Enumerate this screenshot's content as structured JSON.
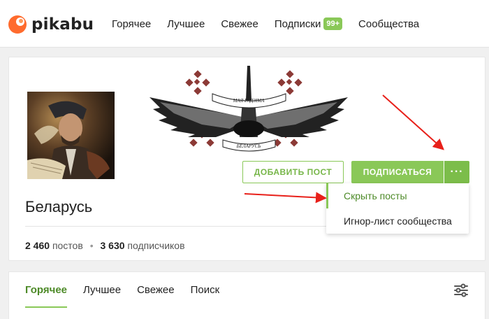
{
  "header": {
    "logo_text": "pikabu",
    "nav": [
      {
        "label": "Горячее"
      },
      {
        "label": "Лучшее"
      },
      {
        "label": "Свежее"
      },
      {
        "label": "Подписки",
        "badge": "99+"
      },
      {
        "label": "Сообщества"
      }
    ]
  },
  "community": {
    "title": "Беларусь",
    "banner_text_top": "МАЯ РАДЗІМА",
    "banner_text_bottom": "БЕЛАРУСЬ",
    "posts_count": "2 460",
    "posts_label": "постов",
    "separator": "•",
    "subscribers_count": "3 630",
    "subscribers_label": "подписчиков",
    "add_post_label": "ДОБАВИТЬ ПОСТ",
    "subscribe_label": "ПОДПИСАТЬСЯ",
    "more_label": "···"
  },
  "dropdown": {
    "items": [
      {
        "label": "Скрыть посты"
      },
      {
        "label": "Игнор-лист сообщества"
      }
    ]
  },
  "tabs": [
    {
      "label": "Горячее"
    },
    {
      "label": "Лучшее"
    },
    {
      "label": "Свежее"
    },
    {
      "label": "Поиск"
    }
  ],
  "colors": {
    "accent": "#8ac858",
    "accent_dark": "#4d8a28",
    "annotation_arrow": "#e8201a"
  },
  "icons": {
    "logo": "pikabu-logo-icon",
    "more": "more-dots-icon",
    "filter": "filter-settings-icon"
  }
}
